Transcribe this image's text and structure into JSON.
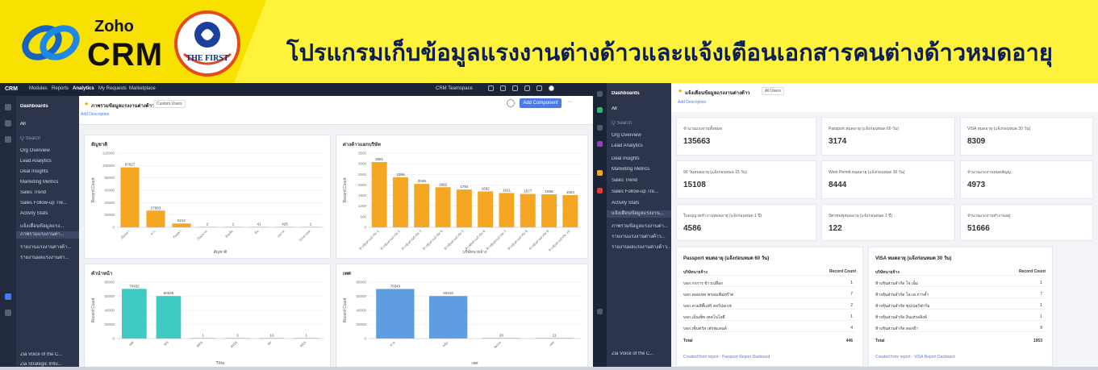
{
  "banner": {
    "brand_top": "Zoho",
    "brand_bottom": "CRM",
    "seal_text": "THE FIRST",
    "headline": "โปรแกรมเก็บข้อมูลแรงงานต่างด้าวและแจ้งเตือนเอกสารคนต่างด้าวหมดอายุ",
    "colors": {
      "banner": "#f8e000",
      "headline": "#0b1f56"
    }
  },
  "crm_left": {
    "topnav": [
      "CRM",
      "Modules",
      "Reports",
      "Analytics",
      "My Requests",
      "Marketplace"
    ],
    "active_tab": "Analytics",
    "workspace": "CRM Teamspace",
    "sidebar": {
      "title": "Dashboards",
      "filter": "All",
      "search_placeholder": "Q Search",
      "items": [
        "Org Overview",
        "Lead Analytics",
        "Deal Insights",
        "Marketing Metrics",
        "Sales Trend",
        "Sales Follow-up Tre...",
        "Activity Stats",
        "แจ้งเตือนข้อมูลแรง...",
        "ภาพรวมแรงงานต่า...",
        "รายงานแรงงานต่างด้า...",
        "รายงานผลแรงงานต่า..."
      ],
      "selected_index": 8,
      "footer_1": "Zia Voice of the C...",
      "footer_2": "Zia Strategic Influ..."
    },
    "dashboard": {
      "title": "ภาพรวมข้อมูลแรงงานต่างด้าว",
      "view_filter": "Custom Users",
      "add_description": "Add Description",
      "add_component_button": "Add Component"
    }
  },
  "crm_right": {
    "sidebar": {
      "title": "Dashboards",
      "filter": "All",
      "search_placeholder": "Q Search",
      "items": [
        "Org Overview",
        "Lead Analytics",
        "Deal Insights",
        "Marketing Metrics",
        "Sales Trend",
        "Sales Follow-up Tre...",
        "Activity Stats",
        "แจ้งเตือนข้อมูลแรงงาน...",
        "ภาพรวมข้อมูลแรงงานต่า...",
        "รายงานแรงงานต่างด้าว...",
        "รายงานผลแรงงานต่างด้าว..."
      ],
      "selected_index": 7,
      "footer": "Zia Voice of the C..."
    },
    "dashboard": {
      "title": "แจ้งเตือนข้อมูลแรงงานต่างด้าว",
      "view_filter": "All Users",
      "add_description": "Add Description"
    },
    "kpis": [
      {
        "label": "จำนวนแรงงานทั้งหมด",
        "value": "135663"
      },
      {
        "label": "Passport หมดอายุ (แจ้งก่อนหมด 60 วัน)",
        "value": "3174"
      },
      {
        "label": "VISA หมดอายุ (แจ้งก่อนหมด 30 วัน)",
        "value": "8309"
      },
      {
        "label": "90 วันหมดอายุ (แจ้งก่อนหมด 15 วัน)",
        "value": "15108"
      },
      {
        "label": "Work Permit หมดอายุ (แจ้งก่อนหมด 30 วัน)",
        "value": "8444"
      },
      {
        "label": "จำนวนแรงงานหมดสัญญ",
        "value": "4973"
      },
      {
        "label": "ใบอนุญาตทำงานหมดอายุ (แจ้งก่อนหมด 1 ปี)",
        "value": "4586"
      },
      {
        "label": "บัตรชมพูหมดอายุ (แจ้งก่อนหมด 1 ปี)",
        "value": "122"
      },
      {
        "label": "จำนวนแรงงานทำงานอยู่",
        "value": "51666"
      }
    ],
    "passport_table": {
      "title": "Passport หมดอายุ (แจ้งก่อนหมด 60 วัน)",
      "col1": "บริษัทนายจ้าง",
      "col2": "Record Count",
      "rows": [
        [
          "บจก.กรการ ข้าวเปลือก",
          "1"
        ],
        [
          "บจก.คอมเทค พรอบเพิ่มทร๊าด",
          "7"
        ],
        [
          "บจก.ควอลิตี้แฟร์ คอร์ปอเรช",
          "2"
        ],
        [
          "บจก.เอ็นเซ็ท เทคโนโลยี",
          "1"
        ],
        [
          "บจก.เซ็นทรัล เฟรชแลนด์",
          "4"
        ]
      ],
      "total_label": "Total",
      "total_value": "446",
      "footer": "Created from report - Passport Report Dasboard"
    },
    "visa_table": {
      "title": "VISA หมดอายุ (แจ้งก่อนหมด 30 วัน)",
      "col1": "บริษัทนายจ้าง",
      "col2": "Record Count",
      "rows": [
        [
          "ห้างหุ้นส่วนจำกัด โจ เอ็ม",
          "1"
        ],
        [
          "ห้างหุ้นส่วนจำกัด โอ.เค.การค้ำ",
          "7"
        ],
        [
          "ห้างหุ้นส่วนจำกัด ซุปเปอร์ฟาร์ม",
          "1"
        ],
        [
          "ห้างหุ้นส่วนจำกัด อินเท่รอลิงค์",
          "1"
        ],
        [
          "ห้างหุ้นส่วนจำกัด ดอกฝ้า",
          "9"
        ]
      ],
      "total_label": "Total",
      "total_value": "1953",
      "footer": "Created from report - VISA Report Dasboard"
    }
  },
  "chart_data": [
    {
      "type": "bar",
      "title": "สัญชาติ",
      "xlabel": "สัญชาติ",
      "ylabel": "Record Count",
      "categories": [
        "เมียนมา",
        "ลาว",
        "กัมพูชา",
        "เวียดนาม",
        "อินเดีย",
        "จีน",
        "เนปาล",
        "บังกลาเทศ"
      ],
      "values": [
        97027,
        27063,
        6212,
        2,
        1,
        41,
        425,
        1
      ],
      "ylim": [
        0,
        120000
      ],
      "yticks": [
        0,
        20000,
        40000,
        60000,
        80000,
        100000,
        120000
      ],
      "color": "#f5a623"
    },
    {
      "type": "bar",
      "title": "ต่างด้าวแยกบริษัท",
      "xlabel": "บริษัทนายจ้าง",
      "ylabel": "Record Count",
      "categories": [
        "ห้างหุ้นส่วนจำกัด 1",
        "ห้างหุ้นส่วนจำกัด 2",
        "ห้างหุ้นส่วนจำกัด 3",
        "ห้างหุ้นส่วนจำกัด 4",
        "ห้างหุ้นส่วนจำกัด 5",
        "ห้างหุ้นส่วนจำกัด 6",
        "ห้างหุ้นส่วนจำกัด 7",
        "ห้างหุ้นส่วนจำกัด 8",
        "ห้างหุ้นส่วนจำกัด 9",
        "ห้างหุ้นส่วนจำกัด 10"
      ],
      "values": [
        3081,
        2366,
        2049,
        1892,
        1784,
        1692,
        1621,
        1577,
        1558,
        1524
      ],
      "ylim": [
        0,
        3500
      ],
      "yticks": [
        0,
        500,
        1000,
        1500,
        2000,
        2500,
        3000,
        3500
      ],
      "color": "#f5a623"
    },
    {
      "type": "bar",
      "title": "คำนำหน้า",
      "xlabel": "Title",
      "ylabel": "Record Count",
      "categories": [
        "MR",
        "MS",
        "MRS",
        "MISS",
        "Mr",
        "MSS"
      ],
      "values": [
        70452,
        60346,
        1,
        3,
        10,
        1
      ],
      "ylim": [
        0,
        80000
      ],
      "yticks": [
        0,
        20000,
        40000,
        60000,
        80000
      ],
      "color": "#3ec9c2"
    },
    {
      "type": "bar",
      "title": "เพศ",
      "xlabel": "เพศ",
      "ylabel": "Record Count",
      "categories": [
        "ชาย",
        "หญิง",
        "None",
        "เพศ"
      ],
      "values": [
        70343,
        60316,
        20,
        11
      ],
      "ylim": [
        0,
        80000
      ],
      "yticks": [
        0,
        20000,
        40000,
        60000,
        80000
      ],
      "color": "#5e9ee0"
    }
  ]
}
